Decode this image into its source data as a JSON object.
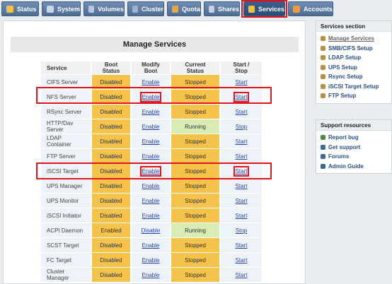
{
  "nav": {
    "tabs": [
      {
        "label": "Status",
        "color": "#f2c14a"
      },
      {
        "label": "System",
        "color": "#c9d6e8"
      },
      {
        "label": "Volumes",
        "color": "#b9c7dc"
      },
      {
        "label": "Cluster",
        "color": "#9fb3cf"
      },
      {
        "label": "Quota",
        "color": "#e8a640"
      },
      {
        "label": "Shares",
        "color": "#c7d0dd"
      },
      {
        "label": "Services",
        "color": "#f3c230"
      },
      {
        "label": "Accounts",
        "color": "#f09a3e"
      }
    ],
    "active": "Services"
  },
  "main": {
    "title": "Manage Services",
    "columns": [
      "Service",
      "Boot Status",
      "Modify Boot",
      "Current Status",
      "Start / Stop"
    ],
    "rows": [
      {
        "service": "CIFS Server",
        "boot": "Disabled",
        "modify": "Enable",
        "status": "Stopped",
        "action": "Start"
      },
      {
        "service": "NFS Server",
        "boot": "Disabled",
        "modify": "Enable",
        "status": "Stopped",
        "action": "Start"
      },
      {
        "service": "RSync Server",
        "boot": "Disabled",
        "modify": "Enable",
        "status": "Stopped",
        "action": "Start"
      },
      {
        "service": "HTTP/Dav Server",
        "boot": "Disabled",
        "modify": "Enable",
        "status": "Running",
        "action": "Stop"
      },
      {
        "service": "LDAP Container",
        "boot": "Disabled",
        "modify": "Enable",
        "status": "Stopped",
        "action": "Start"
      },
      {
        "service": "FTP Server",
        "boot": "Disabled",
        "modify": "Enable",
        "status": "Stopped",
        "action": "Start"
      },
      {
        "service": "iSCSI Target",
        "boot": "Disabled",
        "modify": "Enable",
        "status": "Stopped",
        "action": "Start"
      },
      {
        "service": "UPS Manager",
        "boot": "Disabled",
        "modify": "Enable",
        "status": "Stopped",
        "action": "Start"
      },
      {
        "service": "UPS Monitor",
        "boot": "Disabled",
        "modify": "Enable",
        "status": "Stopped",
        "action": "Start"
      },
      {
        "service": "iSCSI Initiator",
        "boot": "Disabled",
        "modify": "Enable",
        "status": "Stopped",
        "action": "Start"
      },
      {
        "service": "ACPI Daemon",
        "boot": "Enabled",
        "modify": "Disable",
        "status": "Running",
        "action": "Stop"
      },
      {
        "service": "SCST Target",
        "boot": "Disabled",
        "modify": "Enable",
        "status": "Stopped",
        "action": "Start"
      },
      {
        "service": "FC Target",
        "boot": "Disabled",
        "modify": "Enable",
        "status": "Stopped",
        "action": "Start"
      },
      {
        "service": "Cluster Manager",
        "boot": "Disabled",
        "modify": "Enable",
        "status": "Stopped",
        "action": "Start"
      }
    ]
  },
  "sidebar": {
    "services_title": "Services section",
    "services_items": [
      {
        "label": "Manage Services",
        "icon": "gear-icon",
        "color": "#b8923a"
      },
      {
        "label": "SMB/CIFS Setup",
        "icon": "gear-icon",
        "color": "#b8923a"
      },
      {
        "label": "LDAP Setup",
        "icon": "gear-icon",
        "color": "#b8923a"
      },
      {
        "label": "UPS Setup",
        "icon": "gear-icon",
        "color": "#b8923a"
      },
      {
        "label": "Rsync Setup",
        "icon": "gear-icon",
        "color": "#b8923a"
      },
      {
        "label": "iSCSI Target Setup",
        "icon": "gear-icon",
        "color": "#b8923a"
      },
      {
        "label": "FTP Setup",
        "icon": "gear-icon",
        "color": "#b8923a"
      }
    ],
    "support_title": "Support resources",
    "support_items": [
      {
        "label": "Report bug",
        "icon": "bug-icon",
        "color": "#4f8a3a"
      },
      {
        "label": "Get support",
        "icon": "support-icon",
        "color": "#3a6a9a"
      },
      {
        "label": "Forums",
        "icon": "forum-icon",
        "color": "#3a6a9a"
      },
      {
        "label": "Admin Guide",
        "icon": "book-icon",
        "color": "#3a6a9a"
      }
    ]
  }
}
